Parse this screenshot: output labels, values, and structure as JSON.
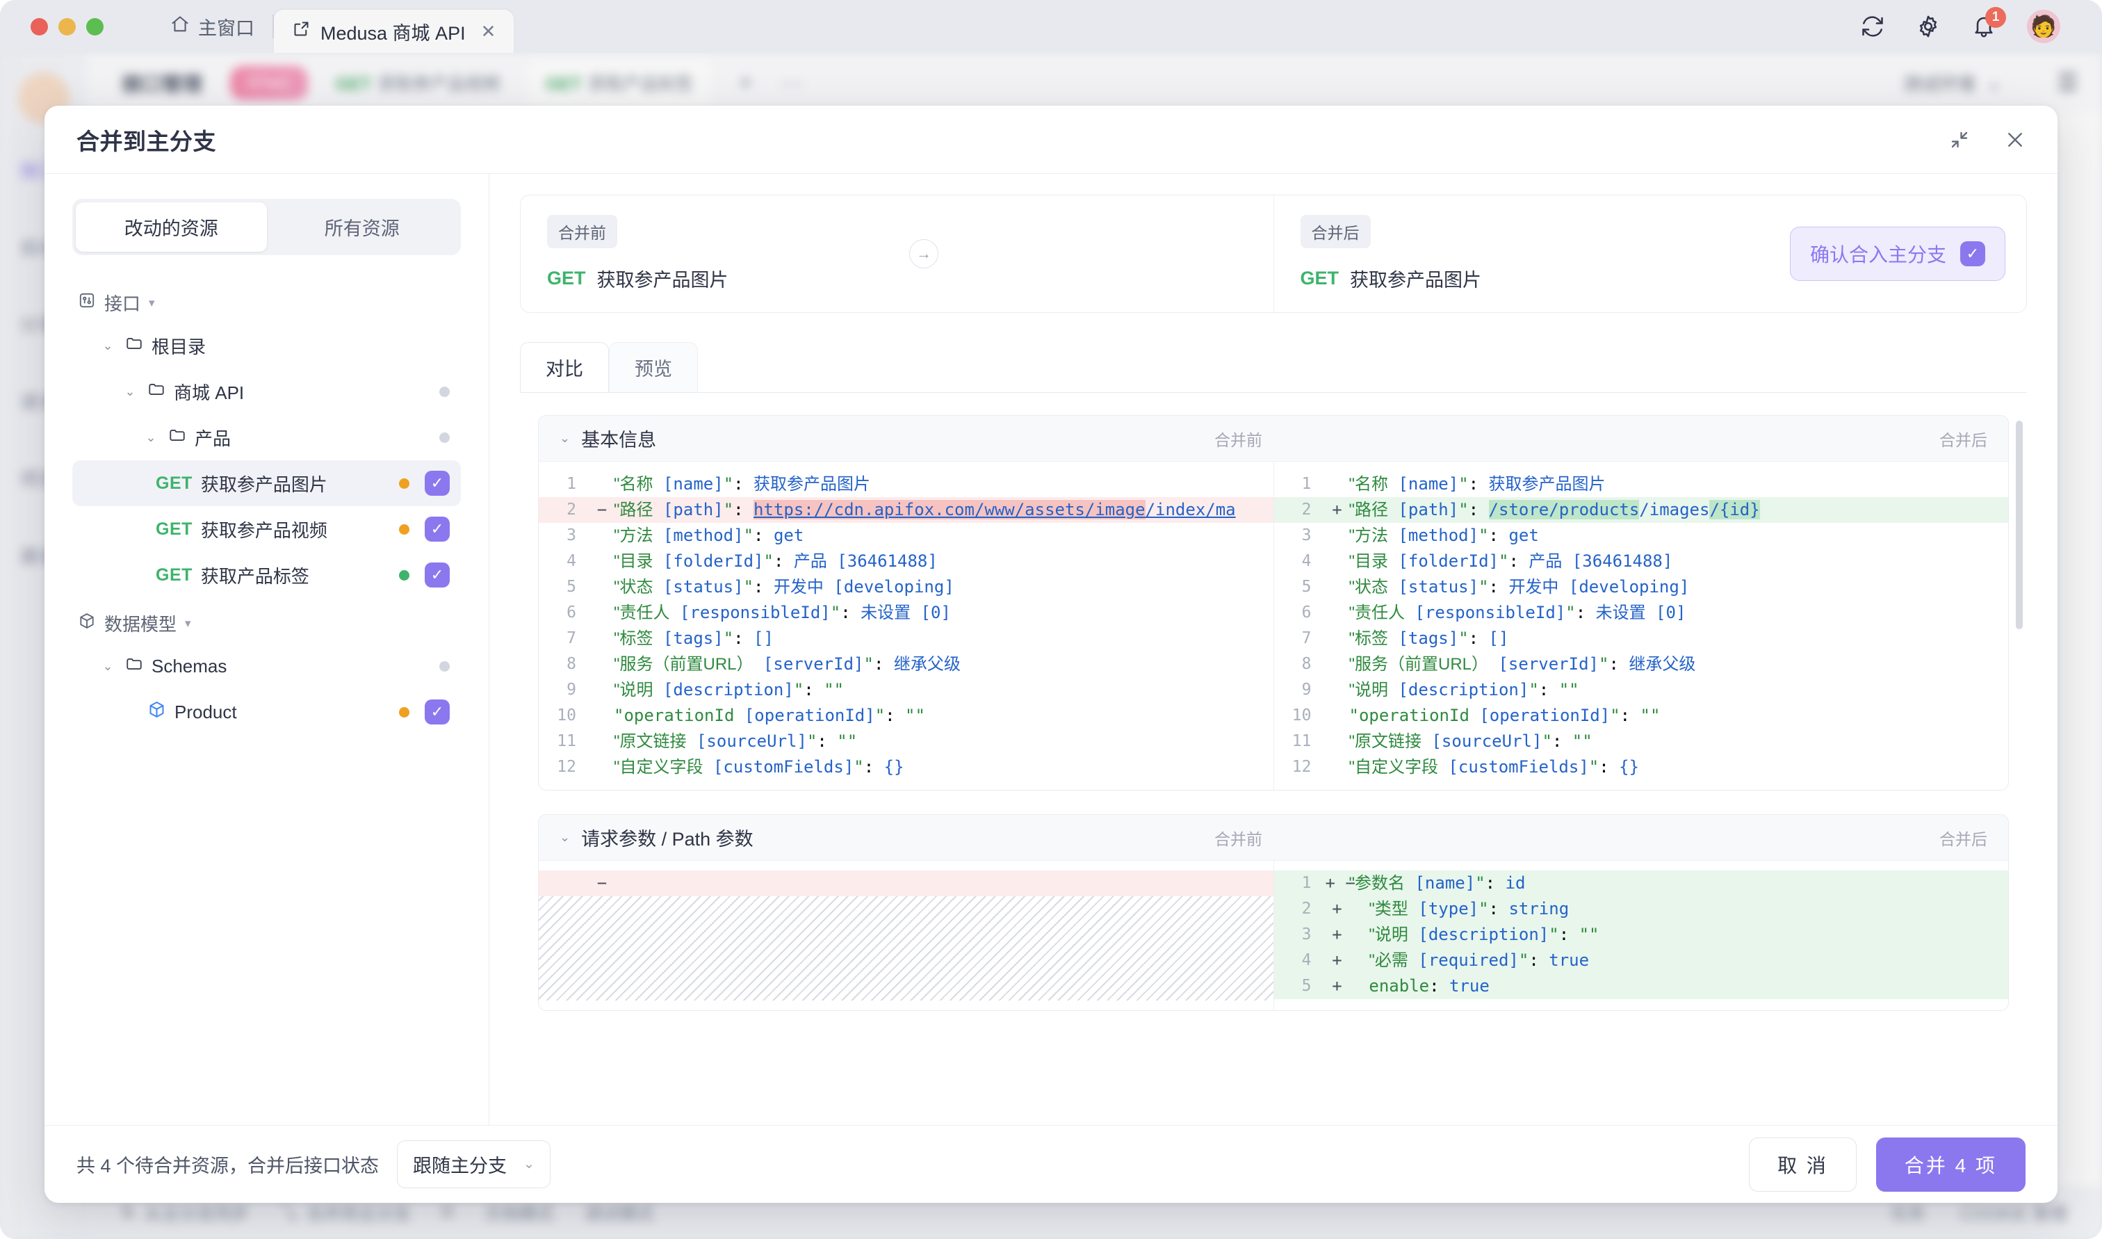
{
  "window": {
    "home_tab_label": "主窗口",
    "doc_tab_label": "Medusa 商城 API",
    "close_tab_glyph": "✕",
    "notification_count": "1",
    "avatar_glyph": "🧑"
  },
  "background": {
    "rail_items": [
      {
        "label": "接口",
        "active": true
      },
      {
        "label": "自动",
        "active": false
      },
      {
        "label": "分享",
        "active": false
      },
      {
        "label": "请求",
        "active": false
      },
      {
        "label": "项目",
        "active": false
      },
      {
        "label": "邀请",
        "active": false
      }
    ],
    "topbar": {
      "title": "接口管理",
      "branch_pill": "07w1",
      "tabs": [
        {
          "method": "GET",
          "label": "获取参产品视频",
          "selected": false
        },
        {
          "method": "GET",
          "label": "获取产品标签",
          "selected": true
        }
      ],
      "add_glyph": "+",
      "more_glyph": "···",
      "env_label": "测试环境",
      "menu_glyph": "☰"
    },
    "bottombar": {
      "items": [
        "从主分支同步",
        "合并到主分支",
        "R",
        "文档模式",
        "调试模式"
      ],
      "right_items": [
        "任务",
        "COOKIE 管理"
      ]
    }
  },
  "dialog": {
    "title": "合并到主分支",
    "collapse_icon": "collapse-icon",
    "close_icon": "close-icon",
    "segmented": {
      "options": [
        "改动的资源",
        "所有资源"
      ],
      "active_index": 0
    },
    "tree": [
      {
        "type": "group",
        "icon": "api-icon",
        "label": "接口",
        "caret": "▾"
      },
      {
        "type": "folder",
        "indent": 1,
        "caret": "⌄",
        "label": "根目录",
        "dot": null,
        "checked": false
      },
      {
        "type": "folder",
        "indent": 2,
        "caret": "⌄",
        "label": "商城 API",
        "dot": "grey",
        "checked": false
      },
      {
        "type": "folder",
        "indent": 3,
        "caret": "⌄",
        "label": "产品",
        "dot": "grey",
        "checked": false
      },
      {
        "type": "api",
        "indent": 4,
        "method": "GET",
        "label": "获取参产品图片",
        "dot": "orange",
        "checked": true,
        "selected": true
      },
      {
        "type": "api",
        "indent": 4,
        "method": "GET",
        "label": "获取参产品视频",
        "dot": "orange",
        "checked": true,
        "selected": false
      },
      {
        "type": "api",
        "indent": 4,
        "method": "GET",
        "label": "获取产品标签",
        "dot": "green",
        "checked": true,
        "selected": false
      },
      {
        "type": "group",
        "icon": "schema-icon",
        "label": "数据模型",
        "caret": "▾"
      },
      {
        "type": "folder",
        "indent": 1,
        "caret": "⌄",
        "label": "Schemas",
        "dot": "grey",
        "checked": false
      },
      {
        "type": "schema",
        "indent": 2,
        "label": "Product",
        "dot": "orange",
        "checked": true,
        "selected": false
      }
    ],
    "compare": {
      "before_tag": "合并前",
      "after_tag": "合并后",
      "before_method": "GET",
      "before_name": "获取参产品图片",
      "after_method": "GET",
      "after_name": "获取参产品图片",
      "arrow_glyph": "→",
      "confirm_label": "确认合入主分支",
      "confirm_check": "✓"
    },
    "view_tabs": [
      {
        "label": "对比",
        "active": true
      },
      {
        "label": "预览",
        "active": false
      }
    ],
    "sections": [
      {
        "title": "基本信息",
        "before_label": "合并前",
        "after_label": "合并后",
        "before_lines": [
          {
            "n": "1",
            "sign": "",
            "state": "",
            "html": "<span class=\"k cjk\">\"名称</span> <span class=\"b\">[name]</span><span class=\"k\">\"</span>: <span class=\"b cjk\">获取参产品图片</span>"
          },
          {
            "n": "2",
            "sign": "−",
            "state": "del",
            "html": "<span class=\"k cjk\">\"路径</span> <span class=\"b\">[path]</span><span class=\"k\">\"</span>: <span class=\"link\"><span class=\"hl-del\">https://cdn.apifox.com/www/assets/image</span>/index/ma</span>"
          },
          {
            "n": "3",
            "sign": "",
            "state": "",
            "html": "<span class=\"k cjk\">\"方法</span> <span class=\"b\">[method]</span><span class=\"k\">\"</span>: <span class=\"b\">get</span>"
          },
          {
            "n": "4",
            "sign": "",
            "state": "",
            "html": "<span class=\"k cjk\">\"目录</span> <span class=\"b\">[folderId]</span><span class=\"k\">\"</span>: <span class=\"b cjk\">产品</span> <span class=\"b\">[36461488]</span>"
          },
          {
            "n": "5",
            "sign": "",
            "state": "",
            "html": "<span class=\"k cjk\">\"状态</span> <span class=\"b\">[status]</span><span class=\"k\">\"</span>: <span class=\"b cjk\">开发中</span> <span class=\"b\">[developing]</span>"
          },
          {
            "n": "6",
            "sign": "",
            "state": "",
            "html": "<span class=\"k cjk\">\"责任人</span> <span class=\"b\">[responsibleId]</span><span class=\"k\">\"</span>: <span class=\"b cjk\">未设置</span> <span class=\"b\">[0]</span>"
          },
          {
            "n": "7",
            "sign": "",
            "state": "",
            "html": "<span class=\"k cjk\">\"标签</span> <span class=\"b\">[tags]</span><span class=\"k\">\"</span>: <span class=\"b\">[]</span>"
          },
          {
            "n": "8",
            "sign": "",
            "state": "",
            "html": "<span class=\"k cjk\">\"服务（前置URL）</span> <span class=\"b\">[serverId]</span><span class=\"k\">\"</span>: <span class=\"b cjk\">继承父级</span>"
          },
          {
            "n": "9",
            "sign": "",
            "state": "",
            "html": "<span class=\"k cjk\">\"说明</span> <span class=\"b\">[description]</span><span class=\"k\">\"</span>: <span class=\"k\">\"\"</span>"
          },
          {
            "n": "10",
            "sign": "",
            "state": "",
            "html": "<span class=\"k\">\"operationId</span> <span class=\"b\">[operationId]</span><span class=\"k\">\"</span>: <span class=\"k\">\"\"</span>"
          },
          {
            "n": "11",
            "sign": "",
            "state": "",
            "html": "<span class=\"k cjk\">\"原文链接</span> <span class=\"b\">[sourceUrl]</span><span class=\"k\">\"</span>: <span class=\"k\">\"\"</span>"
          },
          {
            "n": "12",
            "sign": "",
            "state": "",
            "html": "<span class=\"k cjk\">\"自定义字段</span> <span class=\"b\">[customFields]</span><span class=\"k\">\"</span>: <span class=\"b\">{}</span>"
          }
        ],
        "after_lines": [
          {
            "n": "1",
            "sign": "",
            "state": "",
            "html": "<span class=\"k cjk\">\"名称</span> <span class=\"b\">[name]</span><span class=\"k\">\"</span>: <span class=\"b cjk\">获取参产品图片</span>"
          },
          {
            "n": "2",
            "sign": "+",
            "state": "add",
            "html": "<span class=\"k cjk\">\"路径</span> <span class=\"b\">[path]</span><span class=\"k\">\"</span>: <span class=\"b\"><span class=\"hl-add\">/store/products</span>/images<span class=\"hl-add\">/{id}</span></span>"
          },
          {
            "n": "3",
            "sign": "",
            "state": "",
            "html": "<span class=\"k cjk\">\"方法</span> <span class=\"b\">[method]</span><span class=\"k\">\"</span>: <span class=\"b\">get</span>"
          },
          {
            "n": "4",
            "sign": "",
            "state": "",
            "html": "<span class=\"k cjk\">\"目录</span> <span class=\"b\">[folderId]</span><span class=\"k\">\"</span>: <span class=\"b cjk\">产品</span> <span class=\"b\">[36461488]</span>"
          },
          {
            "n": "5",
            "sign": "",
            "state": "",
            "html": "<span class=\"k cjk\">\"状态</span> <span class=\"b\">[status]</span><span class=\"k\">\"</span>: <span class=\"b cjk\">开发中</span> <span class=\"b\">[developing]</span>"
          },
          {
            "n": "6",
            "sign": "",
            "state": "",
            "html": "<span class=\"k cjk\">\"责任人</span> <span class=\"b\">[responsibleId]</span><span class=\"k\">\"</span>: <span class=\"b cjk\">未设置</span> <span class=\"b\">[0]</span>"
          },
          {
            "n": "7",
            "sign": "",
            "state": "",
            "html": "<span class=\"k cjk\">\"标签</span> <span class=\"b\">[tags]</span><span class=\"k\">\"</span>: <span class=\"b\">[]</span>"
          },
          {
            "n": "8",
            "sign": "",
            "state": "",
            "html": "<span class=\"k cjk\">\"服务（前置URL）</span> <span class=\"b\">[serverId]</span><span class=\"k\">\"</span>: <span class=\"b cjk\">继承父级</span>"
          },
          {
            "n": "9",
            "sign": "",
            "state": "",
            "html": "<span class=\"k cjk\">\"说明</span> <span class=\"b\">[description]</span><span class=\"k\">\"</span>: <span class=\"k\">\"\"</span>"
          },
          {
            "n": "10",
            "sign": "",
            "state": "",
            "html": "<span class=\"k\">\"operationId</span> <span class=\"b\">[operationId]</span><span class=\"k\">\"</span>: <span class=\"k\">\"\"</span>"
          },
          {
            "n": "11",
            "sign": "",
            "state": "",
            "html": "<span class=\"k cjk\">\"原文链接</span> <span class=\"b\">[sourceUrl]</span><span class=\"k\">\"</span>: <span class=\"k\">\"\"</span>"
          },
          {
            "n": "12",
            "sign": "",
            "state": "",
            "html": "<span class=\"k cjk\">\"自定义字段</span> <span class=\"b\">[customFields]</span><span class=\"k\">\"</span>: <span class=\"b\">{}</span>"
          }
        ]
      },
      {
        "title": "请求参数 / Path 参数",
        "before_label": "合并前",
        "after_label": "合并后",
        "before_lines": [
          {
            "n": "",
            "sign": "−",
            "state": "del",
            "html": ""
          }
        ],
        "before_hatch": true,
        "after_lines": [
          {
            "n": "1",
            "sign": "+ −",
            "state": "add",
            "html": "<span class=\"k cjk\">\"参数名</span> <span class=\"b\">[name]</span><span class=\"k\">\"</span>: <span class=\"b\">id</span>"
          },
          {
            "n": "2",
            "sign": "+",
            "state": "add",
            "html": "  <span class=\"k cjk\">\"类型</span> <span class=\"b\">[type]</span><span class=\"k\">\"</span>: <span class=\"b\">string</span>"
          },
          {
            "n": "3",
            "sign": "+",
            "state": "add",
            "html": "  <span class=\"k cjk\">\"说明</span> <span class=\"b\">[description]</span><span class=\"k\">\"</span>: <span class=\"k\">\"\"</span>"
          },
          {
            "n": "4",
            "sign": "+",
            "state": "add",
            "html": "  <span class=\"k cjk\">\"必需</span> <span class=\"b\">[required]</span><span class=\"k\">\"</span>: <span class=\"b\">true</span>"
          },
          {
            "n": "5",
            "sign": "+",
            "state": "add",
            "html": "  <span class=\"k\">enable</span>: <span class=\"b\">true</span>"
          }
        ]
      }
    ],
    "footer": {
      "summary": "共 4 个待合并资源，合并后接口状态",
      "status_select_value": "跟随主分支",
      "status_select_caret": "⌄",
      "cancel_label": "取 消",
      "merge_label": "合并 4 项"
    }
  }
}
